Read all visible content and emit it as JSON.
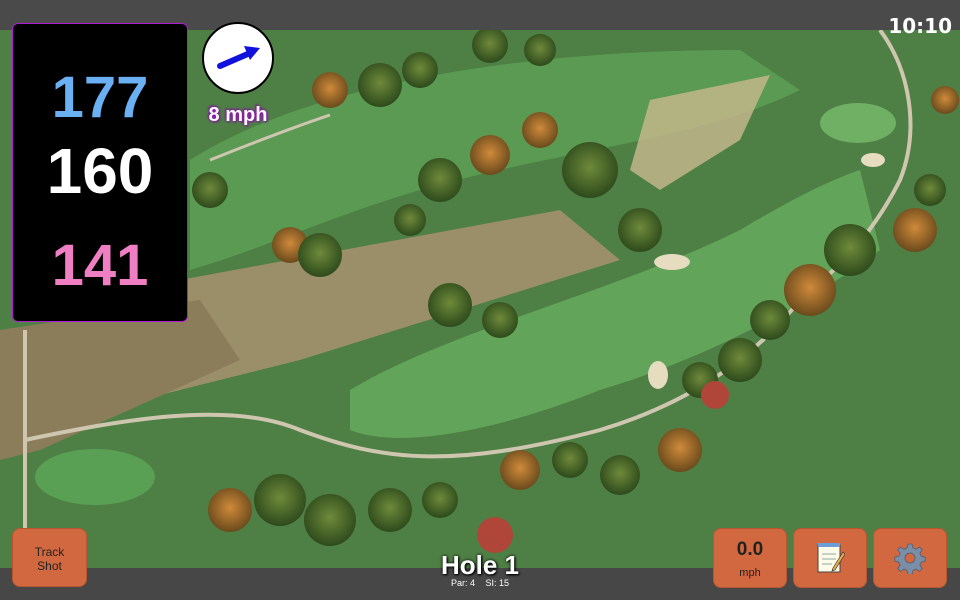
{
  "status": {
    "time": "10:10"
  },
  "distances": {
    "back": "177",
    "middle": "160",
    "front": "141"
  },
  "wind": {
    "speed_label": "8 mph",
    "direction_icon": "arrow-icon"
  },
  "hole": {
    "title": "Hole 1",
    "par_label": "Par: 4",
    "si_label": "SI: 15"
  },
  "buttons": {
    "track_shot": "Track\nShot",
    "speed_value": "0.0",
    "speed_unit": "mph",
    "notes_icon": "notepad-icon",
    "settings_icon": "gear-icon"
  },
  "colors": {
    "back_distance": "#6ab0f2",
    "middle_distance": "#ffffff",
    "front_distance": "#f07ec3",
    "button_accent": "#d1683f",
    "panel_border": "#b01bd3"
  }
}
